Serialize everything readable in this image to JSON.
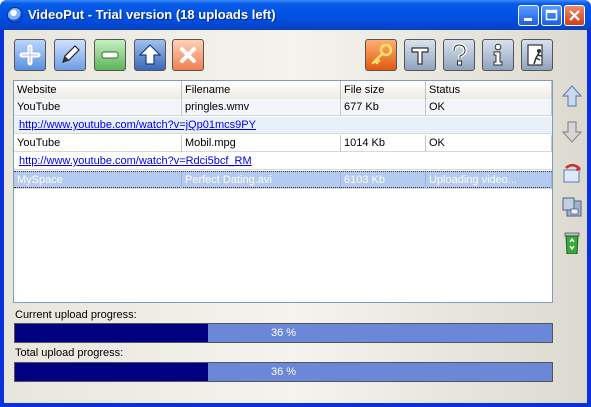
{
  "window": {
    "title": "VideoPut - Trial version (18 uploads left)"
  },
  "toolbar": {
    "left": [
      "add-icon",
      "edit-icon",
      "remove-icon",
      "upload-icon",
      "cancel-icon"
    ],
    "right": [
      "key-icon",
      "tools-icon",
      "help-icon",
      "info-icon",
      "exit-icon"
    ]
  },
  "table": {
    "columns": [
      "Website",
      "Filename",
      "File size",
      "Status"
    ],
    "rows": [
      {
        "website": "YouTube",
        "filename": "pringles.wmv",
        "size": "677 Kb",
        "status": "OK",
        "url": "http://www.youtube.com/watch?v=jQp01mcs9PY"
      },
      {
        "website": "YouTube",
        "filename": "Mobil.mpg",
        "size": "1014 Kb",
        "status": "OK",
        "url": "http://www.youtube.com/watch?v=Rdci5bcf_RM"
      },
      {
        "website": "MySpace",
        "filename": "Perfect Dating.avi",
        "size": "6103 Kb",
        "status": "Uploading video..."
      }
    ]
  },
  "side": [
    "move-up-icon",
    "move-down-icon",
    "open-icon",
    "save-icon",
    "recycle-bin-icon"
  ],
  "progress": {
    "current_label": "Current upload progress:",
    "current_value": 36,
    "current_text": "36 %",
    "total_label": "Total upload progress:",
    "total_value": 36,
    "total_text": "36 %"
  },
  "colors": {
    "titlebar": "#0054e3",
    "progress_fill": "#000080",
    "progress_bg": "#6b88d8",
    "link": "#0000ee"
  }
}
